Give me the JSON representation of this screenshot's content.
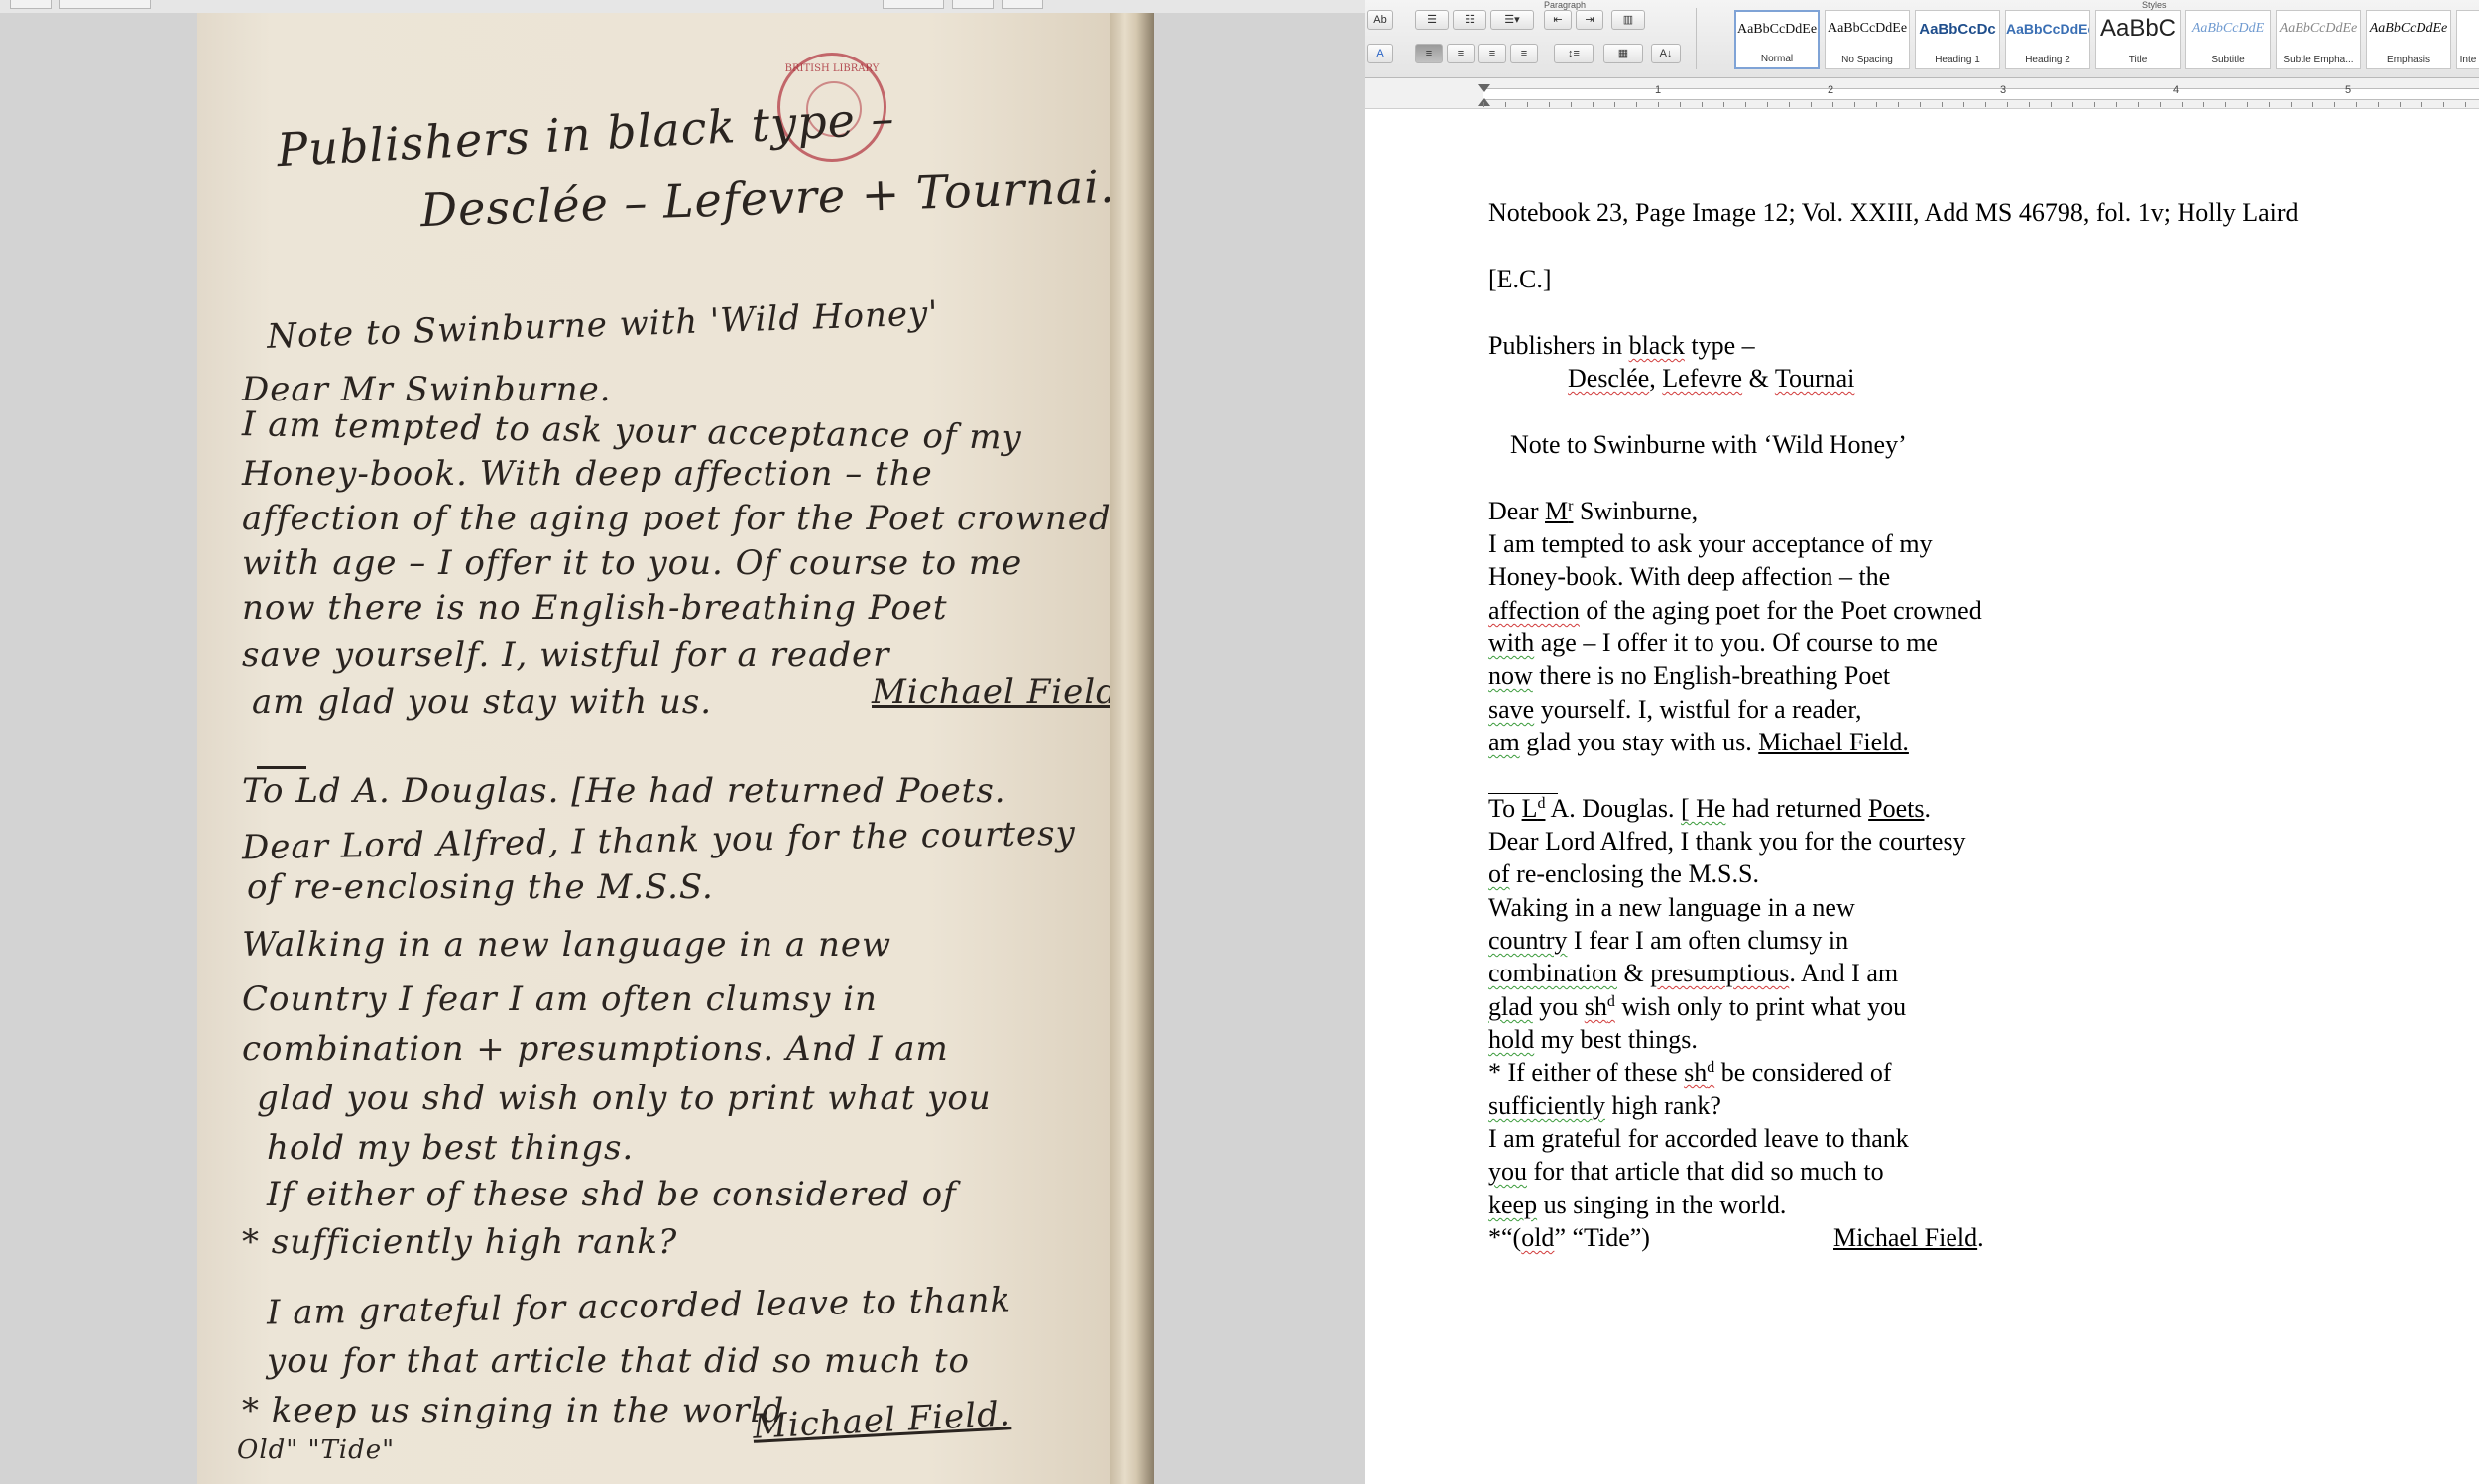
{
  "viewer": {
    "stamp_text": "BRITISH LIBRARY",
    "handwriting": [
      "Publishers in black type –",
      "Desclée – Lefevre + Tournai.",
      "Note to Swinburne with 'Wild Honey'",
      "Dear Mr Swinburne.",
      "I am tempted to ask your acceptance of my",
      "Honey-book. With deep affection – the",
      "affection of the aging poet for the Poet crowned",
      "with age – I offer it to you. Of course to me",
      "now there is no English-breathing Poet",
      "save yourself. I, wistful for a reader",
      "am glad you stay with us.",
      "Michael Field.",
      "To Ld A. Douglas.   [He had returned Poets.",
      "Dear Lord Alfred, I thank you for the courtesy",
      "of re-enclosing the M.S.S.",
      "Walking in a new language in a new",
      "Country I fear I am often clumsy in",
      "combination + presumptions. And I am",
      "glad you shd wish only to print what you",
      "hold my best things.",
      "If either of these shd be considered of",
      "* sufficiently high rank?",
      "I am grateful for accorded leave to thank",
      "you for that article that did so much to",
      "* keep us singing in the world",
      "Michael Field.",
      "Old\" \"Tide\""
    ]
  },
  "ribbon": {
    "group_paragraph": "Paragraph",
    "group_styles": "Styles",
    "styles": [
      {
        "sample": "AaBbCcDdEe",
        "name": "Normal"
      },
      {
        "sample": "AaBbCcDdEe",
        "name": "No Spacing"
      },
      {
        "sample": "AaBbCcDc",
        "name": "Heading 1"
      },
      {
        "sample": "AaBbCcDdEe",
        "name": "Heading 2"
      },
      {
        "sample": "AaBbC",
        "name": "Title"
      },
      {
        "sample": "AaBbCcDdE",
        "name": "Subtitle"
      },
      {
        "sample": "AaBbCcDdEe",
        "name": "Subtle Empha..."
      },
      {
        "sample": "AaBbCcDdEe",
        "name": "Emphasis"
      },
      {
        "sample": "",
        "name": "Inte"
      }
    ],
    "styles_selected": "Normal",
    "colors": {
      "selected_border": "#7fa3d6",
      "spell_error": "#d13a3a",
      "grammar_error": "#3a9a3a"
    }
  },
  "ruler": {
    "numbers": [
      "1",
      "2",
      "3",
      "4",
      "5"
    ]
  },
  "document": {
    "header": "Notebook 23, Page Image 12; Vol. XXIII, Add MS 46798, fol. 1v; Holly Laird",
    "editor": "[E.C.]",
    "publishers_line_a": "Publishers in ",
    "publishers_black": "black",
    "publishers_line_b": " type –",
    "desclee": "Desclée",
    "comma1": ", ",
    "lefevre": "Lefevre",
    "amp": " & ",
    "tournai": "Tournai",
    "note_title": "Note to Swinburne with ‘Wild Honey’",
    "dear_a": "Dear ",
    "dear_mr": "M",
    "dear_sup": "r",
    "dear_b": " Swinburne,",
    "l1": "I am tempted to ask your acceptance of my",
    "l2": "Honey-book. With deep affection – the",
    "l3_a": "affection",
    "l3_b": " of the aging poet for the Poet crowned",
    "l4_a": "with",
    "l4_b": " age – I offer it to you. Of course to me",
    "l5_a": "now",
    "l5_b": " there is no English-breathing Poet",
    "l6_a": "save",
    "l6_b": " yourself.  I, wistful for a reader,",
    "l7_a": "am",
    "l7_b": " glad you stay with us. ",
    "l7_sig": "Michael Field.",
    "to_a": "To ",
    "to_l": "L",
    "to_sup": "d",
    "to_b": " A. Douglas.  ",
    "to_he": "[ He",
    "to_c": " had returned ",
    "to_poets": "Poets",
    "to_d": ".",
    "m1": "Dear Lord Alfred, I thank you for the courtesy",
    "m2_a": "of",
    "m2_b": " re-enclosing the M.S.S.",
    "m3": "Waking in a new language in a new",
    "m4_a": "country",
    "m4_b": " I fear I am often clumsy in",
    "m5_a": "combination",
    "m5_b": " & ",
    "m5_c": "presumptious",
    "m5_d": ".  And I am",
    "m6_a": "glad",
    "m6_b": " you ",
    "m6_sh": "sh",
    "m6_sup": "d",
    "m6_c": " wish only to print what you",
    "m7_a": "hold",
    "m7_b": " my best things.",
    "m8_a": "* If either of these ",
    "m8_sh": "sh",
    "m8_sup": "d",
    "m8_b": " be considered of",
    "m9_a": "sufficiently",
    "m9_b": " high rank?",
    "m10": "I am grateful for accorded leave to thank",
    "m11_a": "you",
    "m11_b": " for that article that did so much to",
    "m12_a": "keep",
    "m12_b": " us singing in the world.",
    "m13_a": "*“(",
    "m13_old": "old",
    "m13_b": "” “Tide”)",
    "m13_sig": "Michael Field",
    "m13_c": "."
  }
}
